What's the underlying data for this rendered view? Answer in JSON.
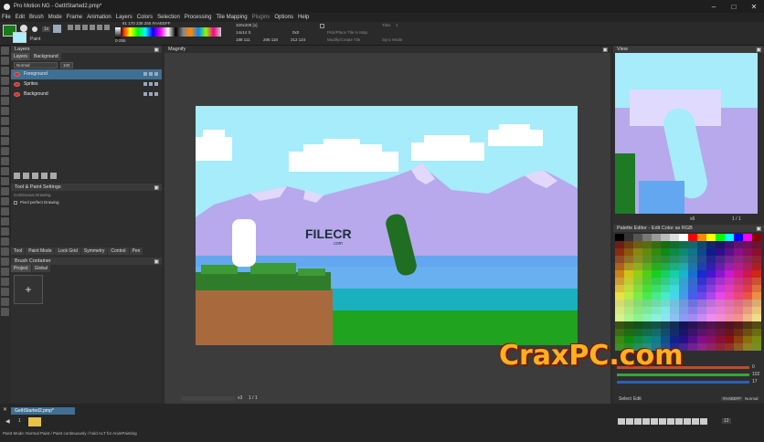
{
  "app": {
    "title": "Pro Motion NG - GetItStarted2.pmp*",
    "window_controls": [
      "minimize-icon",
      "maximize-icon",
      "close-icon"
    ]
  },
  "menu": [
    "File",
    "Edit",
    "Brush",
    "Mode",
    "Frame",
    "Animation",
    "Layers",
    "Colors",
    "Selection",
    "Processing",
    "Tile Mapping",
    "Plugins",
    "Options",
    "Help"
  ],
  "options_bar": {
    "brush_size": "1x",
    "paint_label": "Paint",
    "range_label": "0-255",
    "color_info": "61 170 238 255 #AAEEFF",
    "size_info": "320x200 [1]",
    "zoom_info": "14x14 S",
    "pos1": "188 111",
    "pos2": "206 118",
    "pos3": "212 124",
    "hex1": "0x0",
    "tiles_label": "Tiles",
    "tiles_count": "1",
    "pick_tile": "Pick/Place Tile in Map",
    "modify_tile": "Modify/Create Tile",
    "sync_mode": "Sync Mode"
  },
  "layers_panel": {
    "title": "Layers",
    "tabs": [
      "Layers",
      "Background"
    ],
    "blend_mode": "Normal",
    "opacity": "100",
    "layers": [
      {
        "name": "Foreground",
        "pct": "100%"
      },
      {
        "name": "Sprites",
        "pct": "100%"
      },
      {
        "name": "Background",
        "pct": "100%"
      }
    ]
  },
  "tool_settings": {
    "title": "Tool & Paint Settings",
    "subtitle": "Continuous Drawing",
    "option": "Pixel perfect Drawing",
    "tabs": [
      "Tool",
      "Paint Mode",
      "Lock Grid",
      "Symmetry",
      "Control",
      "Pen"
    ]
  },
  "brush_container": {
    "title": "Brush Container",
    "tabs": [
      "Project",
      "Global"
    ],
    "add": "+"
  },
  "magnify": {
    "title": "Magnify",
    "zoom_level": "x3",
    "page": "1 / 1"
  },
  "watermark": {
    "filecr": "FILECR",
    "filecr_sub": ".com",
    "crax": "CraxPC.com"
  },
  "view_panel": {
    "title": "View",
    "zoom": "x6",
    "page": "1 / 1"
  },
  "palette_panel": {
    "title": "Palette Editor - Edit Color as RGB",
    "rgb": [
      "0",
      "102",
      "17"
    ],
    "hex_value": "#AAEEFF",
    "tabs": [
      "Select",
      "Edit"
    ],
    "normal_label": "Normal"
  },
  "bottom": {
    "file_tab": "GetItStarted2.pmp*",
    "status": "Paint Mode: Normal Paint / Paint continuously / hold ALT for AnimPainting",
    "frame": "12",
    "frame_total": "1"
  },
  "colors": {
    "accent": "#3f6f93",
    "sky": "#a6ecfb",
    "mountain": "#b7a9ec",
    "grass": "#20a31f",
    "water": "#18b1bd"
  }
}
